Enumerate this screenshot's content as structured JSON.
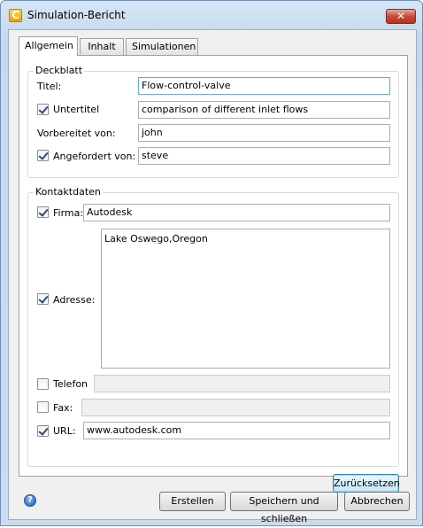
{
  "window": {
    "title": "Simulation-Bericht",
    "close_glyph": "✕",
    "app_icon_letter": "C"
  },
  "tabs": [
    {
      "label": "Allgemein",
      "active": true
    },
    {
      "label": "Inhalt",
      "active": false
    },
    {
      "label": "Simulationen",
      "active": false
    }
  ],
  "cover": {
    "group_label": "Deckblatt",
    "title_label": "Titel:",
    "title_value": "Flow-control-valve",
    "subtitle_label": "Untertitel",
    "subtitle_checked": true,
    "subtitle_value": "comparison of different inlet flows",
    "prepared_label": "Vorbereitet von:",
    "prepared_value": "john",
    "requested_label": "Angefordert von:",
    "requested_checked": true,
    "requested_value": "steve"
  },
  "contact": {
    "group_label": "Kontaktdaten",
    "company_label": "Firma:",
    "company_checked": true,
    "company_value": "Autodesk",
    "address_label": "Adresse:",
    "address_checked": true,
    "address_value": "Lake Oswego,Oregon",
    "phone_label": "Telefon",
    "phone_checked": false,
    "phone_value": "",
    "fax_label": "Fax:",
    "fax_checked": false,
    "fax_value": "",
    "url_label": "URL:",
    "url_checked": true,
    "url_value": "www.autodesk.com"
  },
  "buttons": {
    "reset": "Zurücksetzen",
    "create": "Erstellen",
    "save_close": "Speichern und schließen",
    "cancel": "Abbrechen",
    "help_glyph": "?"
  },
  "icons": {
    "app": "app-logo-icon",
    "help": "help-icon",
    "close": "close-icon"
  },
  "colors": {
    "title_bar": "#c5d9ee",
    "close_button": "#c84a36",
    "default_button_border": "#3c7fb1"
  }
}
